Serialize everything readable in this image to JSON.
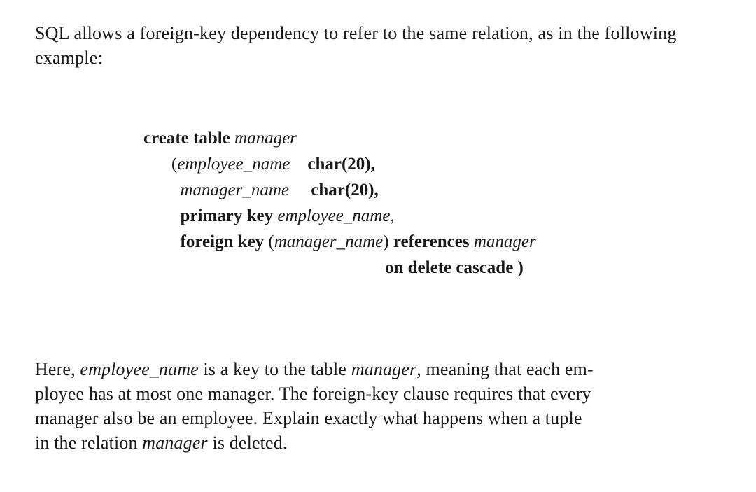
{
  "intro": {
    "part1": "SQL allows a foreign-key dependency to refer to the same relation, as in the following example:"
  },
  "sql": {
    "create_table": "create table",
    "manager": "manager",
    "lparen": "(",
    "employee_name": "employee_name",
    "char20a": "char(20),",
    "manager_name": "manager_name",
    "char20b": "char(20),",
    "primary_key": "primary key",
    "pk_col": "employee_name,",
    "foreign_key": "foreign key",
    "fk_lparen": "(",
    "fk_col": "manager_name",
    "fk_rparen": ")",
    "references": "references",
    "ref_table": "manager",
    "on_delete": "on delete cascade )"
  },
  "body": {
    "p1_a": "Here, ",
    "p1_b": "employee_name",
    "p1_c": " is a key to the table ",
    "p1_d": "manager",
    "p1_e": ", meaning that each em-",
    "p2": "ployee has at most one manager. The foreign-key clause requires that every",
    "p3": "manager also be an employee. Explain exactly what happens when a tuple",
    "p4_a": "in the relation ",
    "p4_b": "manager",
    "p4_c": " is deleted."
  }
}
